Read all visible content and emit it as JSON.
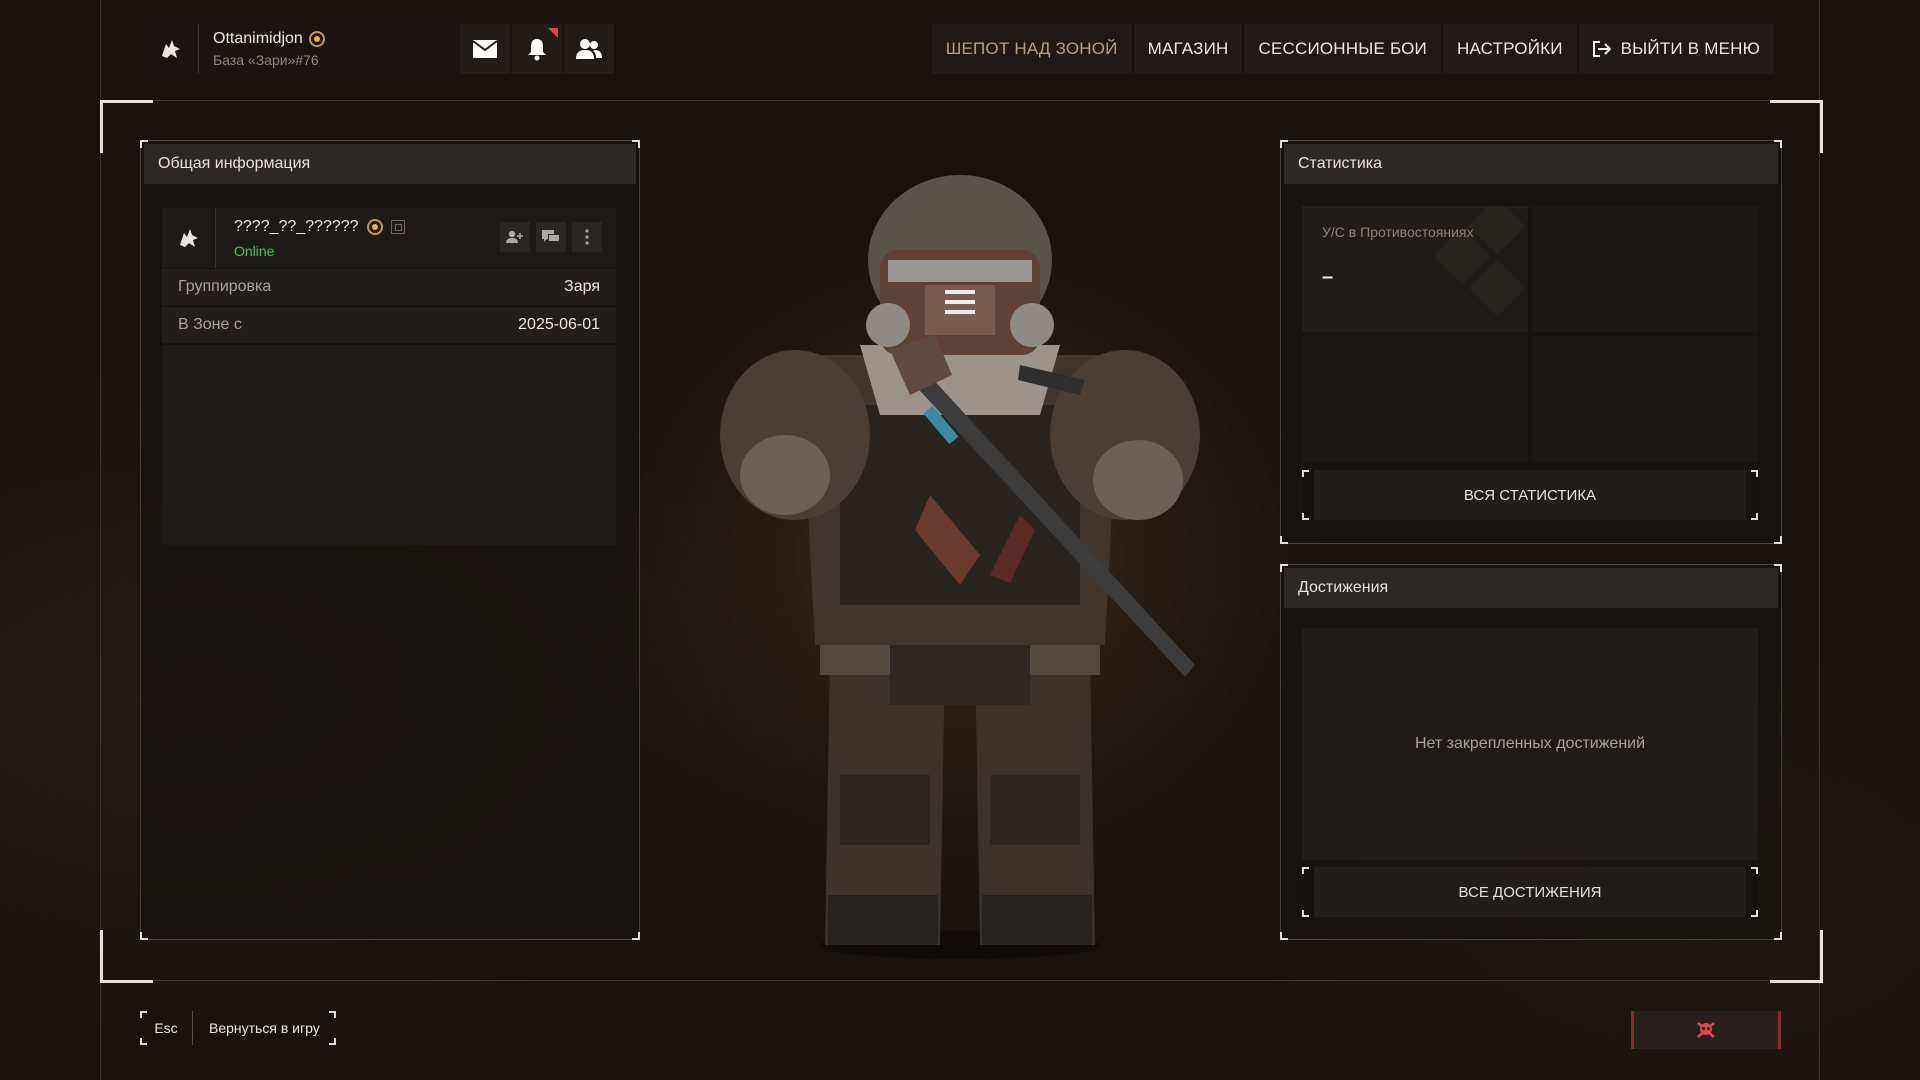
{
  "user": {
    "name": "Ottanimidjon",
    "sub": "База «Зари»#76",
    "icons": [
      "wolf-emblem-icon",
      "gold-badge-icon",
      "mail-icon",
      "bell-icon",
      "friends-icon"
    ]
  },
  "nav": {
    "items": [
      "ШЕПОТ НАД ЗОНОЙ",
      "МАГАЗИН",
      "СЕССИОННЫЕ БОИ",
      "НАСТРОЙКИ"
    ],
    "exit": "ВЫЙТИ В МЕНЮ",
    "active_index": 0
  },
  "general": {
    "title": "Общая информация",
    "player_name": "????_??_??????",
    "status": "Online",
    "rows": [
      {
        "key": "Группировка",
        "value": "Заря"
      },
      {
        "key": "В Зоне с",
        "value": "2025-06-01"
      }
    ]
  },
  "stats": {
    "title": "Статистика",
    "cell_label": "У/С в Противостояниях",
    "cell_value": "–",
    "button": "ВСЯ СТАТИСТИКА"
  },
  "achievements": {
    "title": "Достижения",
    "empty": "Нет закрепленных достижений",
    "button": "ВСЕ ДОСТИЖЕНИЯ"
  },
  "bottom": {
    "esc": "Esc",
    "back": "Вернуться в игру"
  },
  "colors": {
    "online": "#3ec93b",
    "active_tab": "#b9a07a",
    "danger": "#e0444e",
    "gold": "#d19a22"
  }
}
